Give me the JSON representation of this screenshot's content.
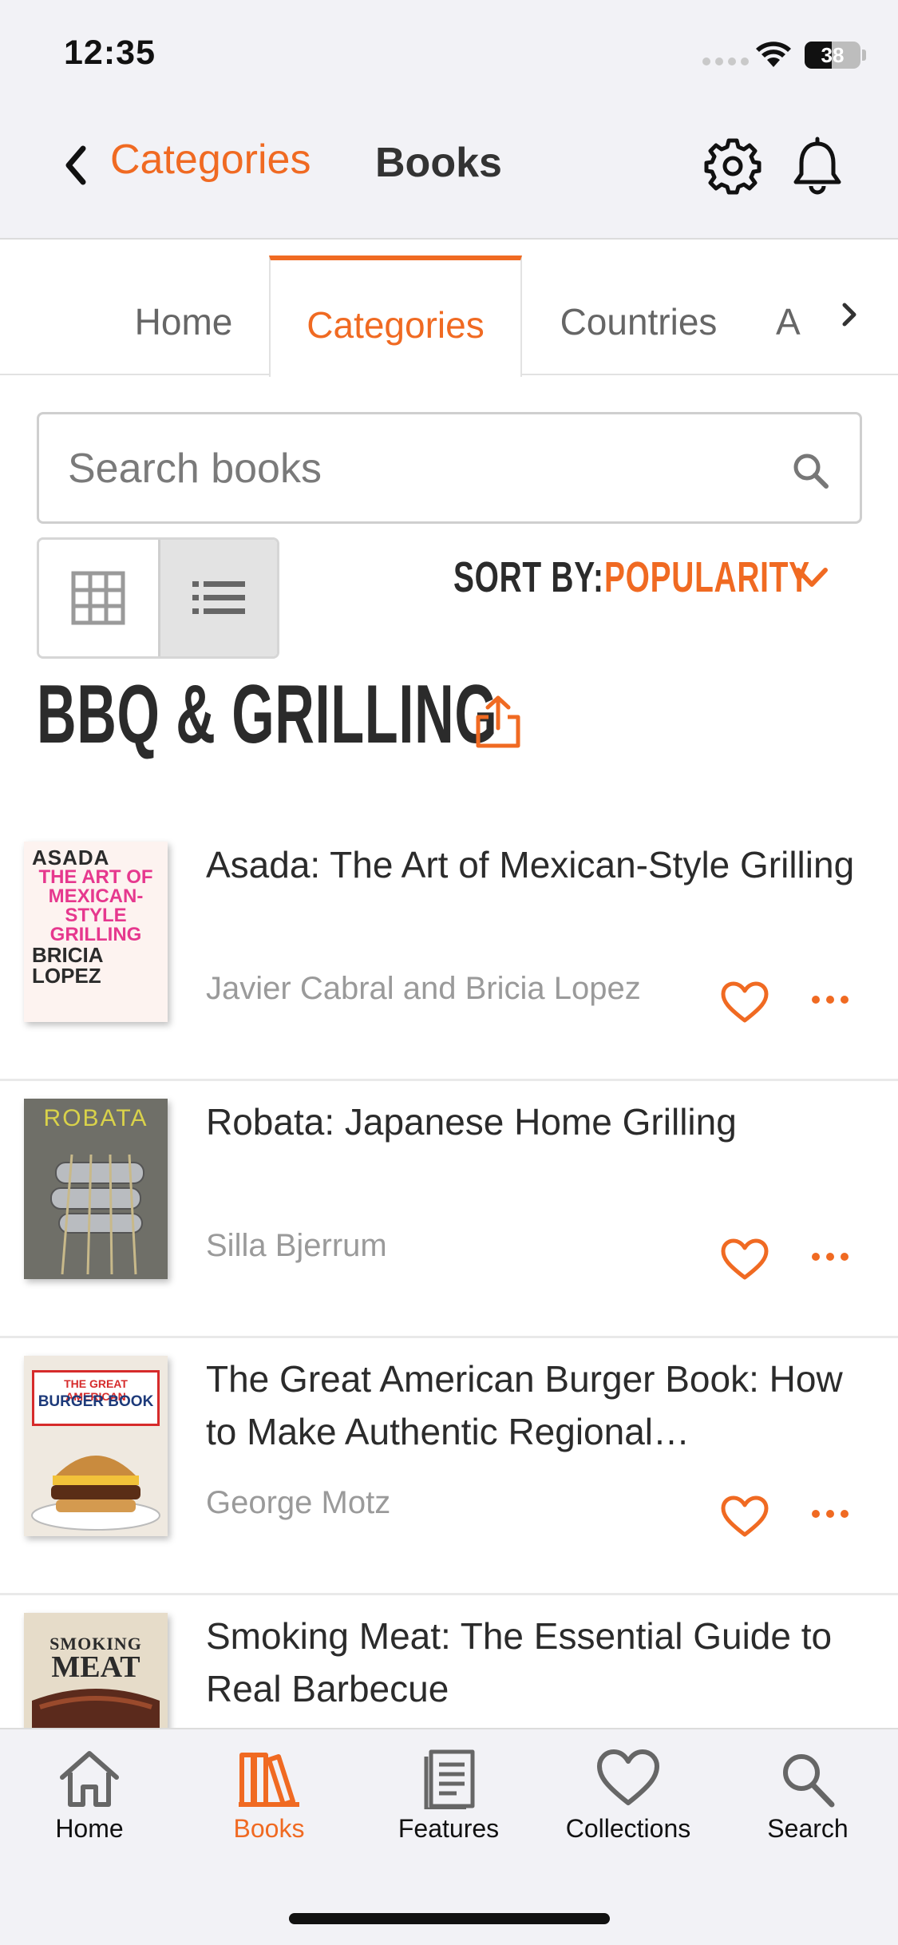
{
  "status_bar": {
    "time": "12:35",
    "battery": "38"
  },
  "nav": {
    "back_label": "Categories",
    "title": "Books"
  },
  "tabs": [
    {
      "label": "Home"
    },
    {
      "label": "Categories"
    },
    {
      "label": "Countries"
    },
    {
      "label": "A"
    }
  ],
  "search": {
    "placeholder": "Search books",
    "value": ""
  },
  "sort": {
    "label": "SORT BY:",
    "value": "POPULARITY"
  },
  "section": {
    "title": "BBQ & GRILLING"
  },
  "books": [
    {
      "title": "Asada: The Art of Mexican-Style Grilling",
      "author": "Javier Cabral and Bricia Lopez",
      "cover_text": [
        "ASADA",
        "THE ART OF MEXICAN- STYLE GRILLING",
        "BRICIA LOPEZ"
      ]
    },
    {
      "title": "Robata: Japanese Home Grilling",
      "author": "Silla Bjerrum",
      "cover_text": [
        "ROBATA"
      ]
    },
    {
      "title": "The Great American Burger Book: How to Make Authentic Regional…",
      "author": "George Motz",
      "cover_text": [
        "THE GREAT AMERICAN",
        "BURGER BOOK"
      ]
    },
    {
      "title": "Smoking Meat: The Essential Guide to Real Barbecue",
      "author": "",
      "cover_text": [
        "SMOKING",
        "MEAT"
      ]
    }
  ],
  "tabbar": [
    {
      "label": "Home",
      "icon": "home-icon"
    },
    {
      "label": "Books",
      "icon": "books-icon"
    },
    {
      "label": "Features",
      "icon": "features-icon"
    },
    {
      "label": "Collections",
      "icon": "heart-icon"
    },
    {
      "label": "Search",
      "icon": "search-icon"
    }
  ],
  "colors": {
    "accent": "#f06a22",
    "text": "#2b2b2b",
    "muted": "#9a9a9a",
    "bar": "#f2f2f6"
  }
}
